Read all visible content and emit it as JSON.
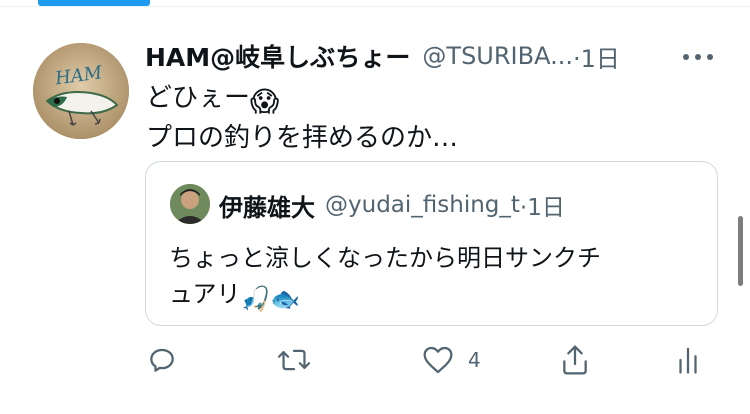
{
  "tweet": {
    "display_name": "HAM@岐阜しぶちょー",
    "handle": "@TSURIBA...",
    "time": "·1日",
    "avatar_text": "HAM",
    "text_line1": "どひぇー",
    "text_emoji1": "😱",
    "text_line2": "プロの釣りを拝めるのか…"
  },
  "quoted_tweet": {
    "display_name": "伊藤雄大",
    "handle": "@yudai_fishing_t",
    "time": "·1日",
    "text_line1": "ちょっと涼しくなったから明日サンクチ",
    "text_line2": "ュアリ",
    "text_emojis": "🎣🐟"
  },
  "actions": {
    "reply_icon": "reply-icon",
    "retweet_icon": "retweet-icon",
    "like_icon": "heart-icon",
    "like_count": "4",
    "share_icon": "share-icon",
    "analytics_icon": "analytics-icon"
  },
  "colors": {
    "accent": "#1d9bf0",
    "text_primary": "#0f1419",
    "text_secondary": "#536471",
    "border": "#cfd9de"
  }
}
